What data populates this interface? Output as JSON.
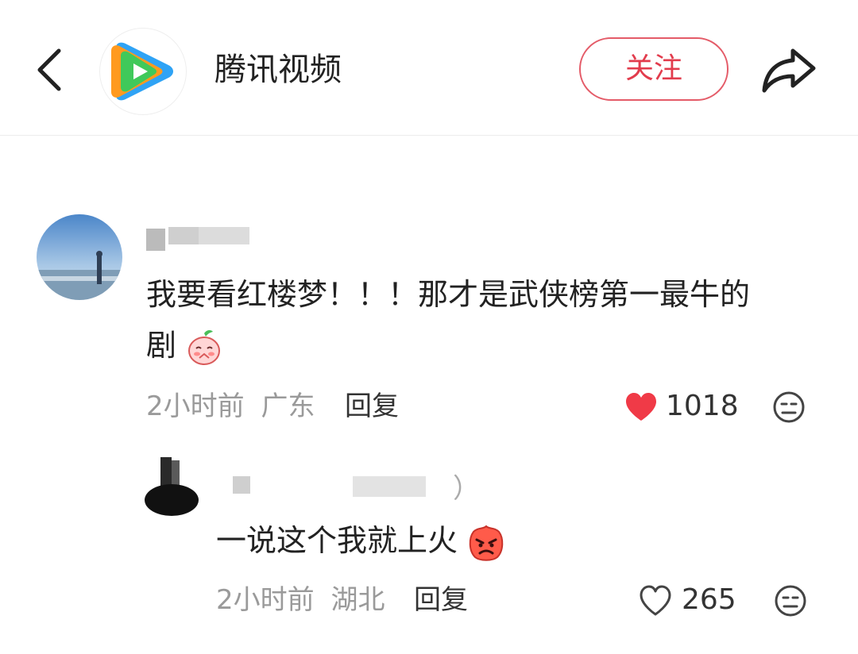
{
  "header": {
    "title": "腾讯视频",
    "follow_label": "关注"
  },
  "comments": [
    {
      "text_line1": "我要看红楼梦！！！那才是武侠榜第一最牛的",
      "text_line2": "剧",
      "time": "2小时前",
      "location": "广东",
      "reply_label": "回复",
      "likes": "1018",
      "liked": true
    },
    {
      "name_suffix": "）",
      "text": "一说这个我就上火",
      "time": "2小时前",
      "location": "湖北",
      "reply_label": "回复",
      "likes": "265",
      "liked": false
    }
  ],
  "colors": {
    "accent": "#e23c4d",
    "like_red": "#f03a47"
  }
}
